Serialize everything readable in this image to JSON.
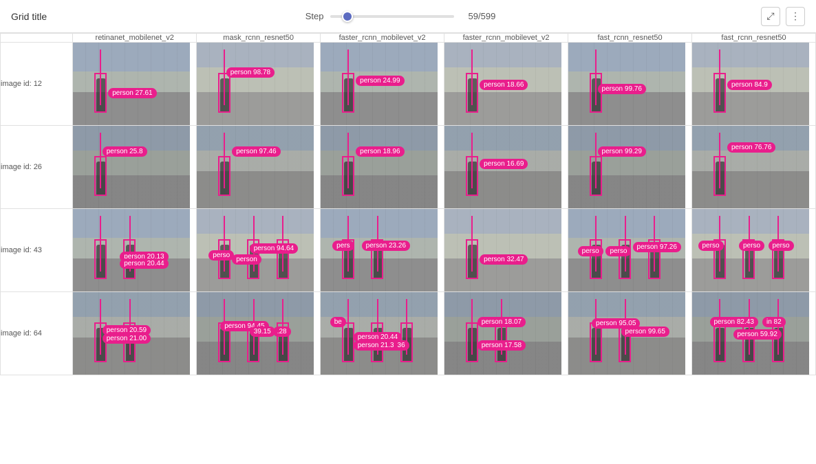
{
  "header": {
    "title": "Grid title",
    "step_label": "Step",
    "step_value": "59/599",
    "step_current": 59,
    "step_max": 599
  },
  "columns": [
    {
      "id": "col0",
      "label": ""
    },
    {
      "id": "col1",
      "label": "retinanet_mobilenet_v2"
    },
    {
      "id": "col2",
      "label": "mask_rcnn_resnet50"
    },
    {
      "id": "col3",
      "label": "faster_rcnn_mobilevet_v2"
    },
    {
      "id": "col4",
      "label": "faster_rcnn_mobilevet_v2"
    },
    {
      "id": "col5",
      "label": "fast_rcnn_resnet50"
    },
    {
      "id": "col6",
      "label": "fast_rcnn_resnet50"
    }
  ],
  "rows": [
    {
      "id": "row1",
      "label": "image id: 12",
      "cells": [
        {
          "labels": [
            {
              "text": "person 27.61",
              "top": "55%",
              "left": "30%"
            }
          ],
          "bg": "street-bg"
        },
        {
          "labels": [
            {
              "text": "person 98.78",
              "top": "30%",
              "left": "25%"
            }
          ],
          "bg": "street-bg-2"
        },
        {
          "labels": [
            {
              "text": "person 24.99",
              "top": "40%",
              "left": "30%"
            }
          ],
          "bg": "street-bg"
        },
        {
          "labels": [
            {
              "text": "person 18.66",
              "top": "45%",
              "left": "30%"
            }
          ],
          "bg": "street-bg-2"
        },
        {
          "labels": [
            {
              "text": "person 99.76",
              "top": "50%",
              "left": "25%"
            }
          ],
          "bg": "street-bg"
        },
        {
          "labels": [
            {
              "text": "person 84.9",
              "top": "45%",
              "left": "30%"
            }
          ],
          "bg": "street-bg-2"
        }
      ]
    },
    {
      "id": "row2",
      "label": "image id: 26",
      "cells": [
        {
          "labels": [
            {
              "text": "person 25.8",
              "top": "25%",
              "left": "25%"
            }
          ],
          "bg": "street-bg-3"
        },
        {
          "labels": [
            {
              "text": "person 97.46",
              "top": "25%",
              "left": "30%"
            }
          ],
          "bg": "street-bg-4"
        },
        {
          "labels": [
            {
              "text": "person 18.96",
              "top": "25%",
              "left": "30%"
            }
          ],
          "bg": "street-bg-3"
        },
        {
          "labels": [
            {
              "text": "person 16.69",
              "top": "40%",
              "left": "30%"
            }
          ],
          "bg": "street-bg-4"
        },
        {
          "labels": [
            {
              "text": "person 99.29",
              "top": "25%",
              "left": "25%"
            }
          ],
          "bg": "street-bg-3"
        },
        {
          "labels": [
            {
              "text": "person 76.76",
              "top": "20%",
              "left": "30%"
            }
          ],
          "bg": "street-bg-4"
        }
      ]
    },
    {
      "id": "row3",
      "label": "image id: 43",
      "cells": [
        {
          "labels": [
            {
              "text": "person 20.13",
              "top": "52%",
              "left": "40%"
            },
            {
              "text": "person 20.44",
              "top": "60%",
              "left": "40%"
            }
          ],
          "bg": "street-bg"
        },
        {
          "labels": [
            {
              "text": "perso",
              "top": "50%",
              "left": "10%"
            },
            {
              "text": "person",
              "top": "55%",
              "left": "30%"
            },
            {
              "text": "person 94.64",
              "top": "42%",
              "left": "45%"
            }
          ],
          "bg": "street-bg-2"
        },
        {
          "labels": [
            {
              "text": "pers",
              "top": "38%",
              "left": "10%"
            },
            {
              "text": "person 23.26",
              "top": "38%",
              "left": "35%"
            }
          ],
          "bg": "street-bg"
        },
        {
          "labels": [
            {
              "text": "person 32.47",
              "top": "55%",
              "left": "30%"
            }
          ],
          "bg": "street-bg-2"
        },
        {
          "labels": [
            {
              "text": "perso",
              "top": "45%",
              "left": "8%"
            },
            {
              "text": "perso",
              "top": "45%",
              "left": "32%"
            },
            {
              "text": "person 97.26",
              "top": "40%",
              "left": "55%"
            }
          ],
          "bg": "street-bg"
        },
        {
          "labels": [
            {
              "text": "perso",
              "top": "38%",
              "left": "5%"
            },
            {
              "text": "perso",
              "top": "38%",
              "left": "40%"
            },
            {
              "text": "perso",
              "top": "38%",
              "left": "65%"
            }
          ],
          "bg": "street-bg-2"
        }
      ]
    },
    {
      "id": "row4",
      "label": "image id: 64",
      "cells": [
        {
          "labels": [
            {
              "text": "person 20.59",
              "top": "40%",
              "left": "25%"
            },
            {
              "text": "person 21.00",
              "top": "50%",
              "left": "25%"
            }
          ],
          "bg": "street-bg-4"
        },
        {
          "labels": [
            {
              "text": "person 94.45",
              "top": "35%",
              "left": "20%"
            },
            {
              "text": "39.15",
              "top": "42%",
              "left": "45%"
            },
            {
              "text": ".28",
              "top": "42%",
              "left": "65%"
            }
          ],
          "bg": "street-bg-3"
        },
        {
          "labels": [
            {
              "text": "be",
              "top": "30%",
              "left": "8%"
            },
            {
              "text": "person 20.44",
              "top": "48%",
              "left": "28%"
            },
            {
              "text": "person 21.33",
              "top": "58%",
              "left": "28%"
            },
            {
              "text": "36",
              "top": "58%",
              "left": "62%"
            }
          ],
          "bg": "street-bg-4"
        },
        {
          "labels": [
            {
              "text": "person 18.07",
              "top": "30%",
              "left": "28%"
            },
            {
              "text": "person 17.58",
              "top": "58%",
              "left": "28%"
            }
          ],
          "bg": "street-bg-3"
        },
        {
          "labels": [
            {
              "text": "person 95.05",
              "top": "32%",
              "left": "20%"
            },
            {
              "text": "person 99.65",
              "top": "42%",
              "left": "45%"
            }
          ],
          "bg": "street-bg-4"
        },
        {
          "labels": [
            {
              "text": "person 82.43",
              "top": "30%",
              "left": "15%"
            },
            {
              "text": "in 82",
              "top": "30%",
              "left": "60%"
            },
            {
              "text": "person 59.92",
              "top": "45%",
              "left": "35%"
            }
          ],
          "bg": "street-bg-3"
        }
      ]
    }
  ]
}
